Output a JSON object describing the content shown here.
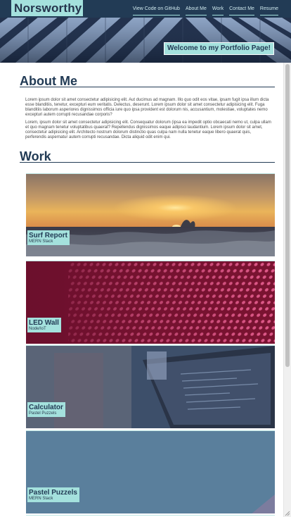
{
  "header": {
    "brand": "Norsworthy",
    "nav": [
      "View Code on GitHub",
      "About Me",
      "Work",
      "Contact Me",
      "Resume"
    ]
  },
  "hero": {
    "welcome": "Welcome to my Portfolio Page!"
  },
  "about": {
    "title": "About Me",
    "paragraphs": [
      "Lorem ipsum dolor sit amet consectetur adipisicing elit. Aut ducimus ad magnam. Illo quo odit eos vitae, ipsam fugit ipsa illum dicta esse blanditiis, tenetur, excepturi eum veritatis. Delectus, deserunt. Lorem ipsum dolor sit amet consectetur adipisicing elit. Fuga blanditiis laborum asperiores dignissimos officia iure quo ipsa provident est dolorum nis, accusantium, molestiae, voluptates nemo excepturi autem corrupti recusandae corporis?",
      "Lorem, ipsum dolor sit amet consectetur adipisicing elit. Consequatur dolorum (ipsa ea impedit optio obcaecati nemo ut, culpa ullam et quo magnam tenetur voluptatibus quaerat? Repellendus dignissimos eaque adipisci laudantium. Lorem ipsum dolor sit amet, consectetur adipisicing elit. Architecto nostrum dolorum distinctio quas culpa nam nulla tenetur eaque libero quaerat quis, perferendis aspernatur autem corrupti recusandae. Dicta aliquid odit enim qui."
    ]
  },
  "work": {
    "title": "Work",
    "projects": [
      {
        "title": "Surf Report",
        "subtitle": "MERN Stack"
      },
      {
        "title": "LED Wall",
        "subtitle": "Node/IoT"
      },
      {
        "title": "Calculator",
        "subtitle": "Pastel Puzzels"
      },
      {
        "title": "Pastel Puzzels",
        "subtitle": "MERN Stack"
      }
    ]
  },
  "colors": {
    "navy": "#223b55",
    "accent": "#a4e1dd"
  }
}
